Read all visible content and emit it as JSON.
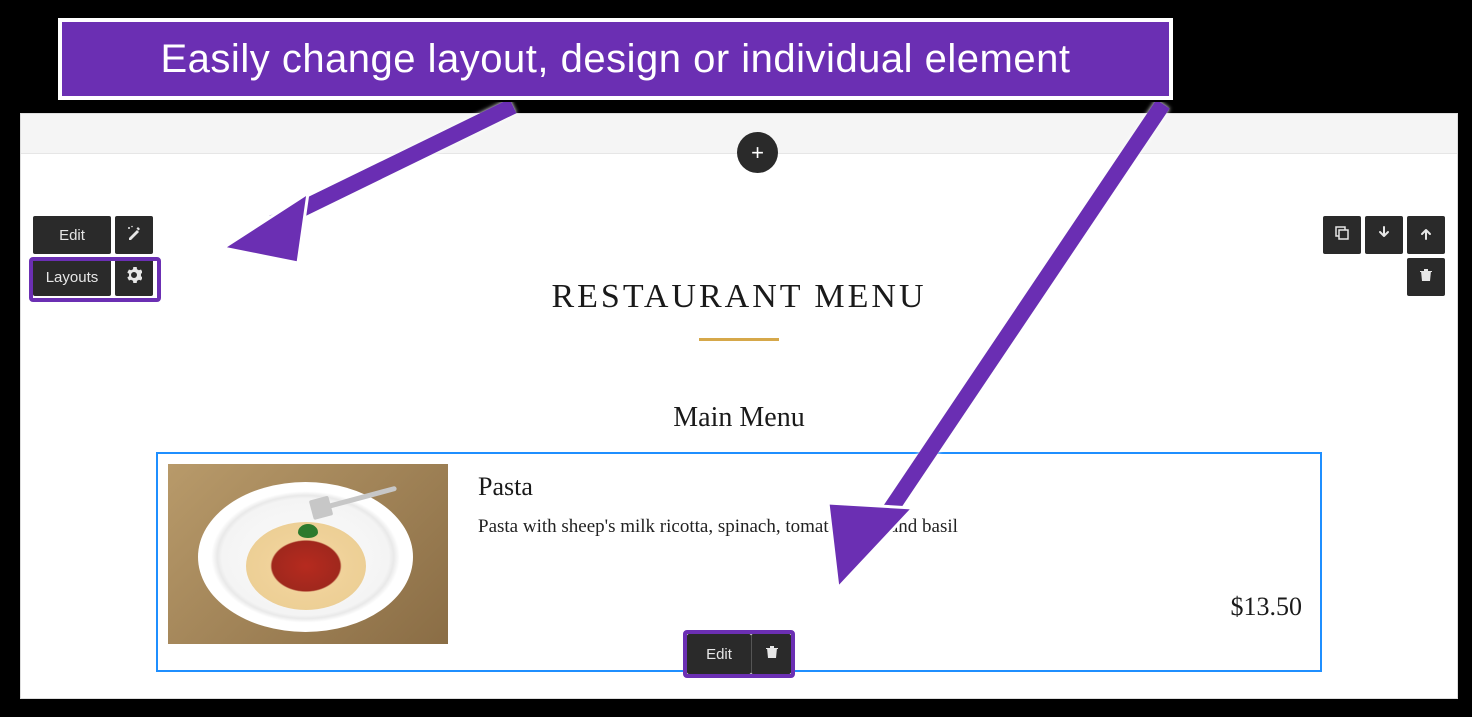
{
  "annotation": {
    "banner_text": "Easily change layout, design or individual element"
  },
  "toolbar_left": {
    "edit_label": "Edit",
    "layouts_label": "Layouts"
  },
  "content": {
    "title": "RESTAURANT MENU",
    "subtitle": "Main Menu",
    "item": {
      "name": "Pasta",
      "description": "Pasta with sheep's milk ricotta, spinach, tomato sauce and basil",
      "price": "$13.50"
    }
  },
  "item_toolbar": {
    "edit_label": "Edit"
  },
  "colors": {
    "accent_purple": "#6b2fb3",
    "selection_blue": "#1f8fff",
    "gold_underline": "#d6a84a"
  }
}
